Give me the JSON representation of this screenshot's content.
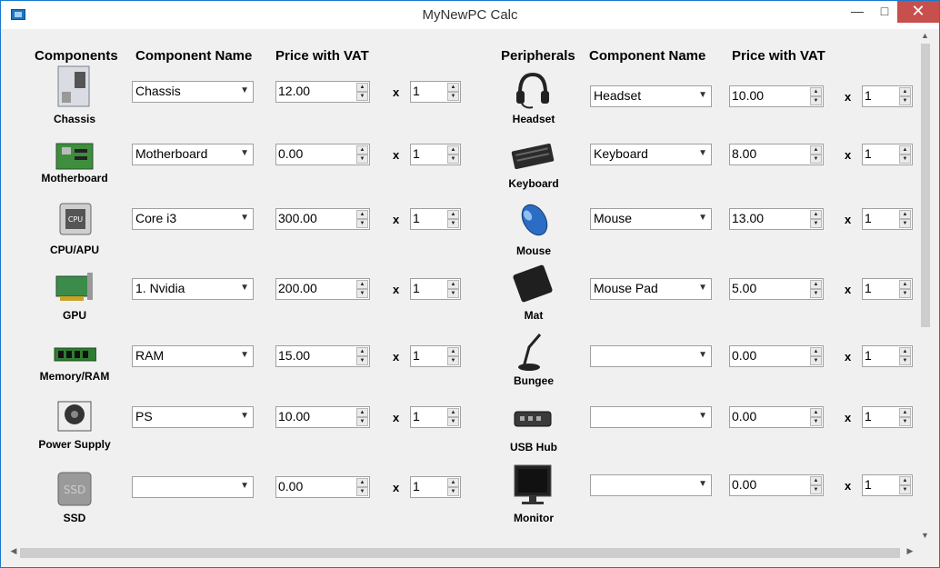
{
  "window": {
    "title": "MyNewPC Calc"
  },
  "headers": {
    "components": "Components",
    "component_name_left": "Component Name",
    "price_left": "Price with VAT",
    "peripherals": "Peripherals",
    "component_name_right": "Component Name",
    "price_right": "Price with VAT"
  },
  "times_symbol": "x",
  "components": [
    {
      "label": "Chassis",
      "icon": "chassis-icon",
      "name": "Chassis",
      "price": "12.00",
      "qty": "1"
    },
    {
      "label": "Motherboard",
      "icon": "motherboard-icon",
      "name": "Motherboard",
      "price": "0.00",
      "qty": "1"
    },
    {
      "label": "CPU/APU",
      "icon": "cpu-icon",
      "name": "Core i3",
      "price": "300.00",
      "qty": "1"
    },
    {
      "label": "GPU",
      "icon": "gpu-icon",
      "name": "1. Nvidia",
      "price": "200.00",
      "qty": "1"
    },
    {
      "label": "Memory/RAM",
      "icon": "ram-icon",
      "name": "RAM",
      "price": "15.00",
      "qty": "1"
    },
    {
      "label": "Power Supply",
      "icon": "power-supply-icon",
      "name": "PS",
      "price": "10.00",
      "qty": "1"
    },
    {
      "label": "SSD",
      "icon": "ssd-icon",
      "name": "",
      "price": "0.00",
      "qty": "1"
    }
  ],
  "peripherals": [
    {
      "label": "Headset",
      "icon": "headset-icon",
      "name": "Headset",
      "price": "10.00",
      "qty": "1"
    },
    {
      "label": "Keyboard",
      "icon": "keyboard-icon",
      "name": "Keyboard",
      "price": "8.00",
      "qty": "1"
    },
    {
      "label": "Mouse",
      "icon": "mouse-icon",
      "name": "Mouse",
      "price": "13.00",
      "qty": "1"
    },
    {
      "label": "Mat",
      "icon": "mouse-mat-icon",
      "name": "Mouse Pad",
      "price": "5.00",
      "qty": "1"
    },
    {
      "label": "Bungee",
      "icon": "bungee-icon",
      "name": "",
      "price": "0.00",
      "qty": "1"
    },
    {
      "label": "USB Hub",
      "icon": "usb-hub-icon",
      "name": "",
      "price": "0.00",
      "qty": "1"
    },
    {
      "label": "Monitor",
      "icon": "monitor-icon",
      "name": "",
      "price": "0.00",
      "qty": "1"
    }
  ]
}
